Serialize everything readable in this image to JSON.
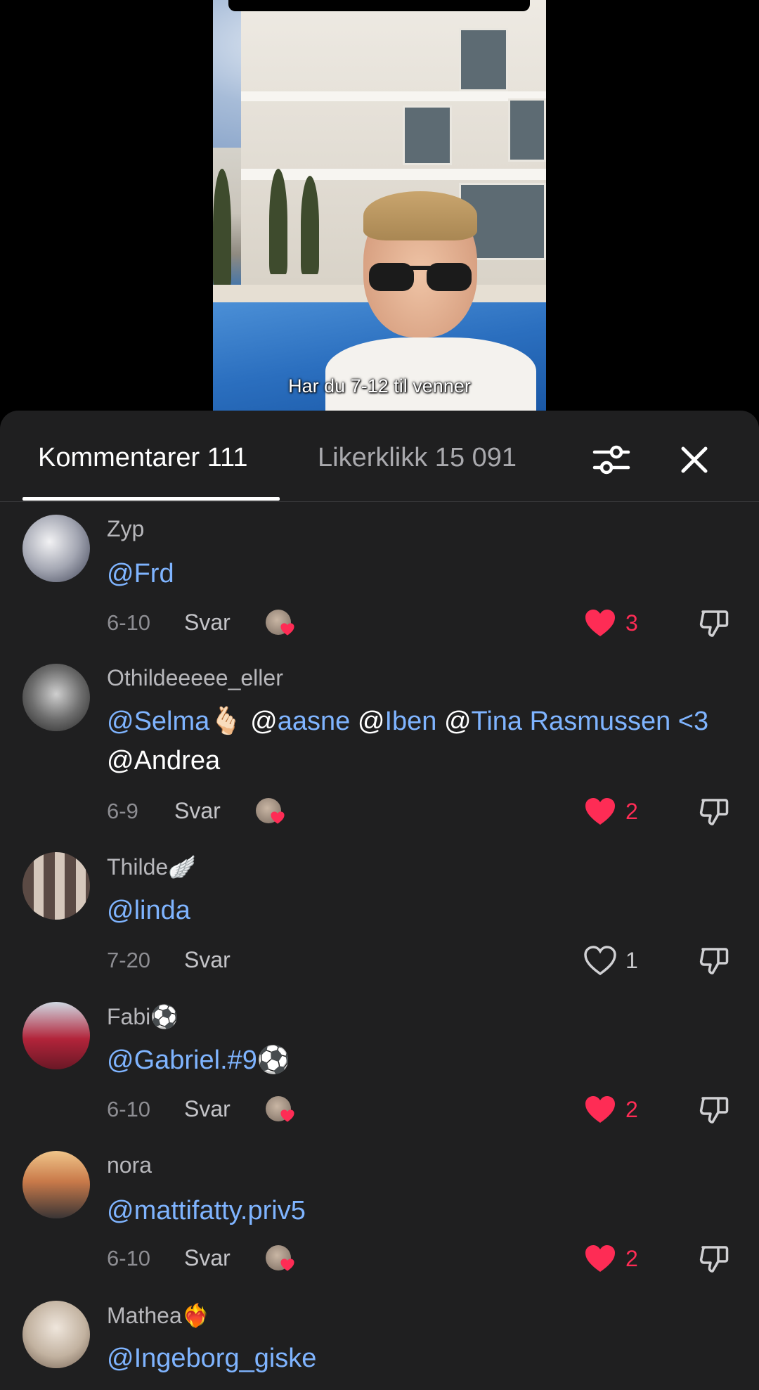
{
  "video": {
    "caption": "Har du 7-12 til venner"
  },
  "tabs": {
    "comments_label": "Kommentarer 111",
    "likes_label": "Likerklikk 15 091"
  },
  "icons": {
    "filter": "sliders-icon",
    "close": "close-icon",
    "like": "heart-icon",
    "dislike": "thumbs-down-icon"
  },
  "colors": {
    "mention": "#7fb4ff",
    "like": "#fe2c55",
    "sheet_bg": "#1f1f20"
  },
  "comments": [
    {
      "username": "Zyp",
      "segments": [
        {
          "t": "@Frd",
          "mention": true
        }
      ],
      "date": "6-10",
      "reply": "Svar",
      "likes": "3",
      "liked": true
    },
    {
      "username": "Othildeeeee_eller",
      "segments": [
        {
          "t": "@Selma",
          "mention": true
        },
        {
          "t": "🫰🏻 ",
          "mention": false
        },
        {
          "t": "@",
          "mention": false
        },
        {
          "t": "aasne",
          "mention": true
        },
        {
          "t": " @",
          "mention": false
        },
        {
          "t": "Iben",
          "mention": true
        },
        {
          "t": " @",
          "mention": false
        },
        {
          "t": "Tina Rasmussen",
          "mention": true
        },
        {
          "t": " <3",
          "mention": true
        },
        {
          "t": " @Andrea",
          "mention": false
        }
      ],
      "date": "6-9",
      "reply": "Svar",
      "likes": "2",
      "liked": true
    },
    {
      "username": "Thilde🪽",
      "segments": [
        {
          "t": "@linda",
          "mention": true
        }
      ],
      "date": "7-20",
      "reply": "Svar",
      "likes": "1",
      "liked": false
    },
    {
      "username": "Fabi⚽",
      "segments": [
        {
          "t": "@Gabriel.#9",
          "mention": true
        },
        {
          "t": "⚽",
          "mention": false
        }
      ],
      "date": "6-10",
      "reply": "Svar",
      "likes": "2",
      "liked": true
    },
    {
      "username": "nora",
      "segments": [
        {
          "t": "@mattifatty.priv5",
          "mention": true
        }
      ],
      "date": "6-10",
      "reply": "Svar",
      "likes": "2",
      "liked": true
    },
    {
      "username": "Mathea❤️‍🔥",
      "segments": [
        {
          "t": "@Ingeborg_giske",
          "mention": true
        }
      ]
    }
  ]
}
